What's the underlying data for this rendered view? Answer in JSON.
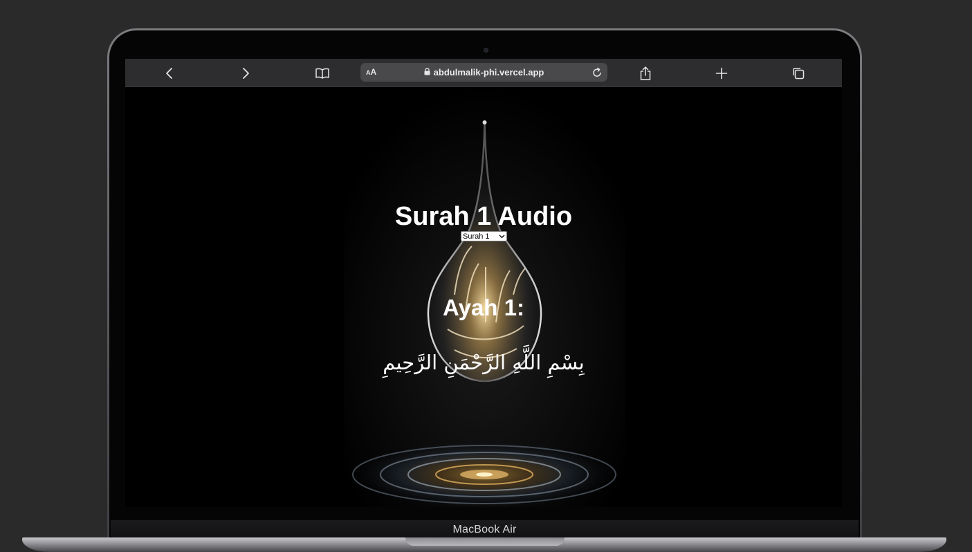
{
  "device": {
    "label": "MacBook Air"
  },
  "browser": {
    "text_size_button": "AA",
    "url": "abdulmalik-phi.vercel.app",
    "icons": {
      "back": "chevron-left-icon",
      "forward": "chevron-right-icon",
      "bookmarks": "book-icon",
      "lock": "lock-icon",
      "reload": "reload-icon",
      "share": "share-icon",
      "new_tab": "plus-icon",
      "tabs": "tabs-icon"
    }
  },
  "page": {
    "title": "Surah 1 Audio",
    "surah_select": {
      "selected": "Surah 1"
    },
    "ayah": {
      "heading": "Ayah 1:",
      "text": "بِسْمِ اللَّهِ الرَّحْمَنِ الرَّحِيمِ"
    }
  }
}
